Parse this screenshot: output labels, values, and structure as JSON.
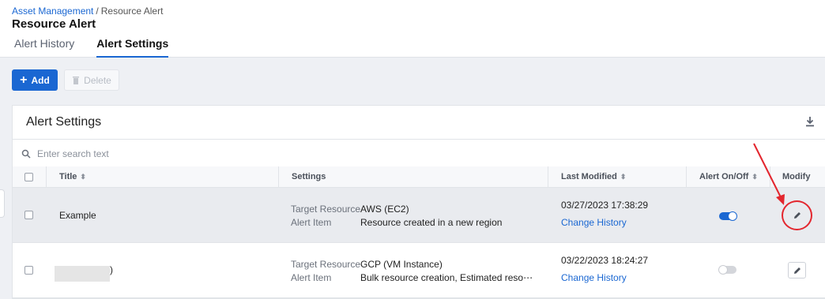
{
  "breadcrumb": {
    "parent": "Asset Management",
    "separator": "/",
    "current": "Resource Alert"
  },
  "page_title": "Resource Alert",
  "tabs": [
    {
      "label": "Alert History",
      "active": false
    },
    {
      "label": "Alert Settings",
      "active": true
    }
  ],
  "toolbar": {
    "add_label": "Add",
    "delete_label": "Delete"
  },
  "panel": {
    "title": "Alert Settings",
    "search_placeholder": "Enter search text"
  },
  "table": {
    "columns": [
      "Title",
      "Settings",
      "Last Modified",
      "Alert On/Off",
      "Modify"
    ],
    "setting_labels": {
      "target": "Target Resource",
      "item": "Alert Item"
    },
    "rows": [
      {
        "title": "Example",
        "target_resource": "AWS (EC2)",
        "alert_item": "Resource created in a new region",
        "last_modified": "03/27/2023 17:38:29",
        "history_link": "Change History",
        "alert_on": true,
        "selected": true
      },
      {
        "title_suffix": ")",
        "target_resource": "GCP (VM Instance)",
        "alert_item": "Bulk resource creation, Estimated reso⋯",
        "last_modified": "03/22/2023 18:24:27",
        "history_link": "Change History",
        "alert_on": false,
        "selected": false
      }
    ]
  },
  "colors": {
    "accent": "#1a67d2",
    "annotation": "#e3262e"
  }
}
